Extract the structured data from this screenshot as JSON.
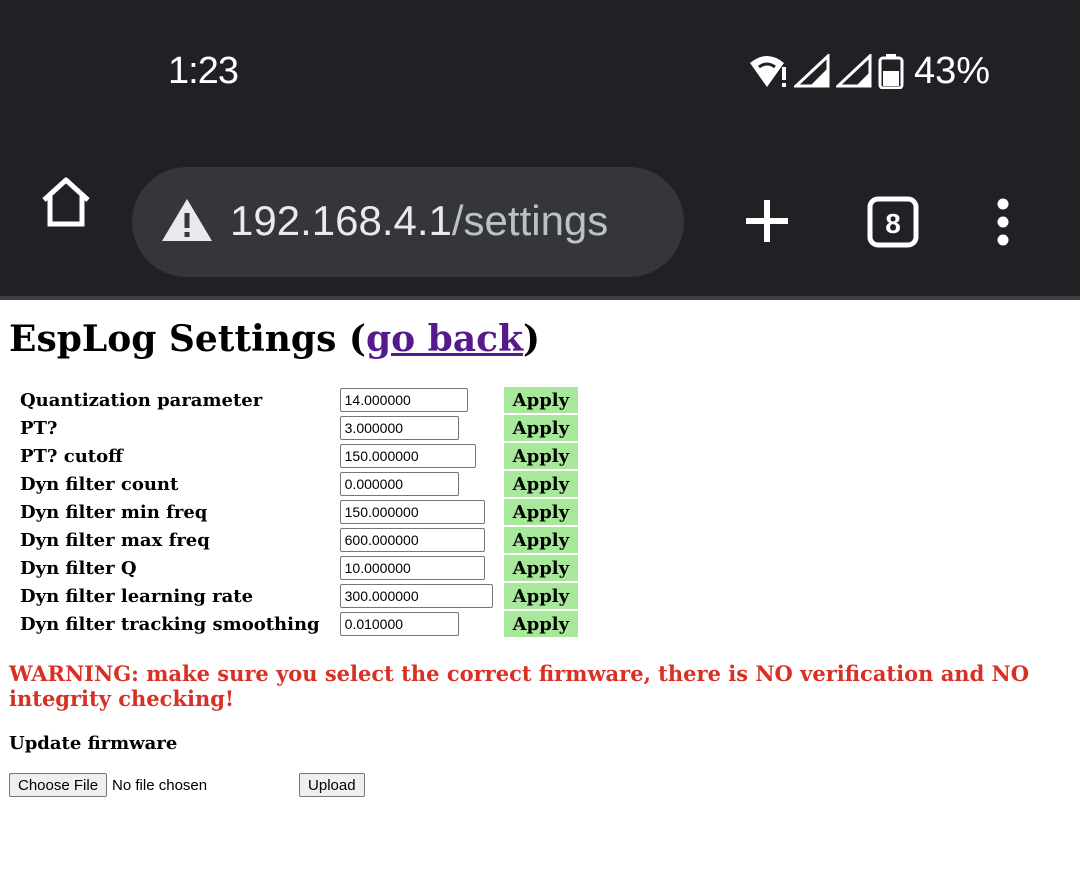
{
  "status_bar": {
    "time": "1:23",
    "battery_percent": "43%",
    "icons": [
      "wifi-warning-icon",
      "signal-icon",
      "signal-icon",
      "battery-icon"
    ]
  },
  "browser": {
    "url_host": "192.168.4.1",
    "url_path": "/settings",
    "tab_count": "8",
    "icons": [
      "home-icon",
      "warning-icon",
      "new-tab-icon",
      "tab-switcher-icon",
      "menu-icon"
    ]
  },
  "page": {
    "title_prefix": "EspLog Settings (",
    "back_link": "go back",
    "title_suffix": ")",
    "apply_label": "Apply",
    "settings": [
      {
        "label": "Quantization parameter",
        "value": "14.000000"
      },
      {
        "label": "PT?",
        "value": "3.000000"
      },
      {
        "label": "PT? cutoff",
        "value": "150.000000"
      },
      {
        "label": "Dyn filter count",
        "value": "0.000000"
      },
      {
        "label": "Dyn filter min freq",
        "value": "150.000000"
      },
      {
        "label": "Dyn filter max freq",
        "value": "600.000000"
      },
      {
        "label": "Dyn filter Q",
        "value": "10.000000"
      },
      {
        "label": "Dyn filter learning rate",
        "value": "300.000000"
      },
      {
        "label": "Dyn filter tracking smoothing",
        "value": "0.010000"
      }
    ],
    "warning": "WARNING: make sure you select the correct firmware, there is NO verification and NO integrity checking!",
    "update_title": "Update firmware",
    "choose_file_label": "Choose File",
    "file_status": "No file chosen",
    "upload_label": "Upload",
    "apply_color": "#a8e89a",
    "warning_color": "#d93025",
    "link_color": "#551a8b"
  }
}
